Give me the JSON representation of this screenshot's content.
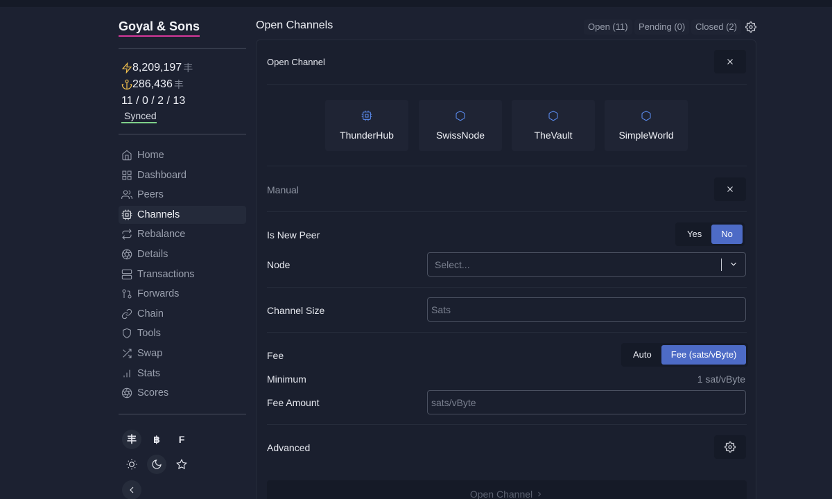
{
  "app": {
    "node_name": "Goyal & Sons"
  },
  "balances": {
    "lightning": "8,209,197",
    "chain": "286,436",
    "sat_symbol": "丰",
    "channel_counts": "11 / 0 / 2 / 13",
    "sync_status": "Synced"
  },
  "nav": {
    "items": [
      {
        "label": "Home",
        "icon": "home-icon"
      },
      {
        "label": "Dashboard",
        "icon": "grid-icon"
      },
      {
        "label": "Peers",
        "icon": "users-icon"
      },
      {
        "label": "Channels",
        "icon": "cpu-icon",
        "active": true
      },
      {
        "label": "Rebalance",
        "icon": "repeat-icon"
      },
      {
        "label": "Details",
        "icon": "aperture-icon"
      },
      {
        "label": "Transactions",
        "icon": "server-icon"
      },
      {
        "label": "Forwards",
        "icon": "git-pull-request-icon"
      },
      {
        "label": "Chain",
        "icon": "link-icon"
      },
      {
        "label": "Tools",
        "icon": "shield-icon"
      },
      {
        "label": "Swap",
        "icon": "shuffle-icon"
      },
      {
        "label": "Stats",
        "icon": "bar-chart-icon"
      },
      {
        "label": "Scores",
        "icon": "aperture-icon"
      }
    ]
  },
  "footer": {
    "currency_sats": "丰",
    "currency_btc": "฿",
    "currency_fiat": "F"
  },
  "header": {
    "title": "Open Channels",
    "tabs": {
      "open": "Open (11)",
      "pending": "Pending (0)",
      "closed": "Closed (2)"
    }
  },
  "open_channel": {
    "title": "Open Channel",
    "nodes": [
      "ThunderHub",
      "SwissNode",
      "TheVault",
      "SimpleWorld"
    ],
    "manual_label": "Manual",
    "new_peer": {
      "label": "Is New Peer",
      "yes": "Yes",
      "no": "No",
      "selected": "No"
    },
    "node": {
      "label": "Node",
      "placeholder": "Select..."
    },
    "channel_size": {
      "label": "Channel Size",
      "placeholder": "Sats"
    },
    "fee": {
      "label": "Fee",
      "auto": "Auto",
      "manual": "Fee (sats/vByte)",
      "selected": "Fee (sats/vByte)"
    },
    "minimum": {
      "label": "Minimum",
      "value": "1 sat/vByte"
    },
    "fee_amount": {
      "label": "Fee Amount",
      "placeholder": "sats/vByte"
    },
    "advanced_label": "Advanced",
    "submit_label": "Open Channel"
  },
  "colors": {
    "background": "#1c2131",
    "accent_blue": "#4d6bc6",
    "node_name_underline": "#d6389a",
    "synced_underline": "#7fd08a"
  }
}
